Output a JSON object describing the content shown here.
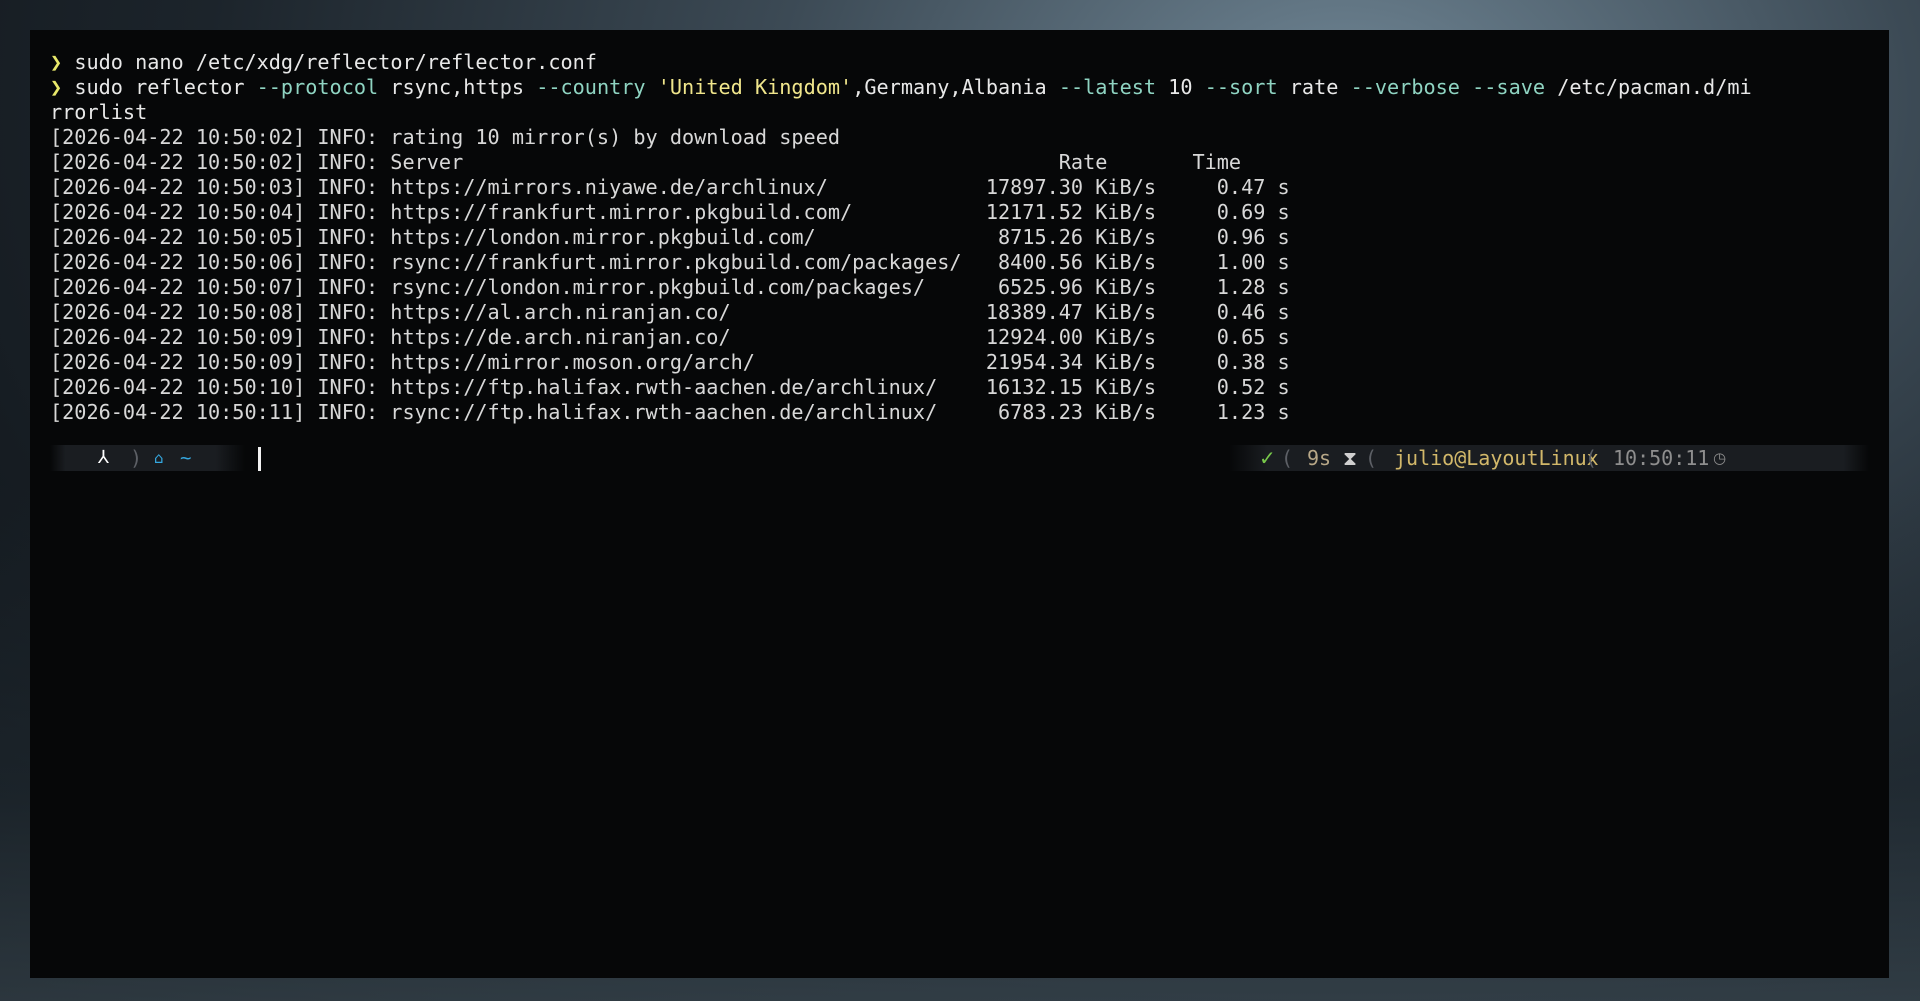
{
  "terminal": {
    "commands": [
      {
        "prompt": "❯",
        "parts": [
          {
            "text": "sudo nano /etc/xdg/reflector/reflector.conf",
            "kind": "plain"
          }
        ]
      },
      {
        "prompt": "❯",
        "parts": [
          {
            "text": "sudo reflector ",
            "kind": "plain"
          },
          {
            "text": "--protocol",
            "kind": "arg"
          },
          {
            "text": " rsync,https ",
            "kind": "plain"
          },
          {
            "text": "--country",
            "kind": "arg"
          },
          {
            "text": " 'United Kingdom'",
            "kind": "str"
          },
          {
            "text": ",Germany,Albania ",
            "kind": "plain"
          },
          {
            "text": "--latest",
            "kind": "arg"
          },
          {
            "text": " 10 ",
            "kind": "plain"
          },
          {
            "text": "--sort",
            "kind": "arg"
          },
          {
            "text": " rate ",
            "kind": "plain"
          },
          {
            "text": "--verbose",
            "kind": "arg"
          },
          {
            "text": " ",
            "kind": "plain"
          },
          {
            "text": "--save",
            "kind": "arg"
          },
          {
            "text": " /etc/pacman.d/mi",
            "kind": "plain"
          }
        ],
        "wrap": "rrorlist"
      }
    ],
    "output": [
      "[2026-04-22 10:50:02] INFO: rating 10 mirror(s) by download speed",
      "[2026-04-22 10:50:02] INFO: Server                                                 Rate       Time",
      "[2026-04-22 10:50:03] INFO: https://mirrors.niyawe.de/archlinux/             17897.30 KiB/s     0.47 s",
      "[2026-04-22 10:50:04] INFO: https://frankfurt.mirror.pkgbuild.com/           12171.52 KiB/s     0.69 s",
      "[2026-04-22 10:50:05] INFO: https://london.mirror.pkgbuild.com/               8715.26 KiB/s     0.96 s",
      "[2026-04-22 10:50:06] INFO: rsync://frankfurt.mirror.pkgbuild.com/packages/   8400.56 KiB/s     1.00 s",
      "[2026-04-22 10:50:07] INFO: rsync://london.mirror.pkgbuild.com/packages/      6525.96 KiB/s     1.28 s",
      "[2026-04-22 10:50:08] INFO: https://al.arch.niranjan.co/                     18389.47 KiB/s     0.46 s",
      "[2026-04-22 10:50:09] INFO: https://de.arch.niranjan.co/                     12924.00 KiB/s     0.65 s",
      "[2026-04-22 10:50:09] INFO: https://mirror.moson.org/arch/                   21954.34 KiB/s     0.38 s",
      "[2026-04-22 10:50:10] INFO: https://ftp.halifax.rwth-aachen.de/archlinux/    16132.15 KiB/s     0.52 s",
      "[2026-04-22 10:50:11] INFO: rsync://ftp.halifax.rwth-aachen.de/archlinux/     6783.23 KiB/s     1.23 s"
    ]
  },
  "prompt_bar": {
    "left": {
      "os_icon": "⅄",
      "separator": ")",
      "home_icon": "⌂",
      "directory": "~"
    },
    "right": {
      "status_icon": "✓",
      "separator": "(",
      "duration": "9s",
      "hourglass_icon": "⧗",
      "user_host": "julio@LayoutLinux",
      "time": "10:50:11",
      "clock_icon": "◷"
    }
  },
  "colors": {
    "prompt_arrow": "#e8e86a",
    "argument": "#8fd4c2",
    "string": "#f0e68c",
    "directory": "#35a8e0",
    "success": "#78c84a",
    "user_host": "#d2b86a"
  }
}
